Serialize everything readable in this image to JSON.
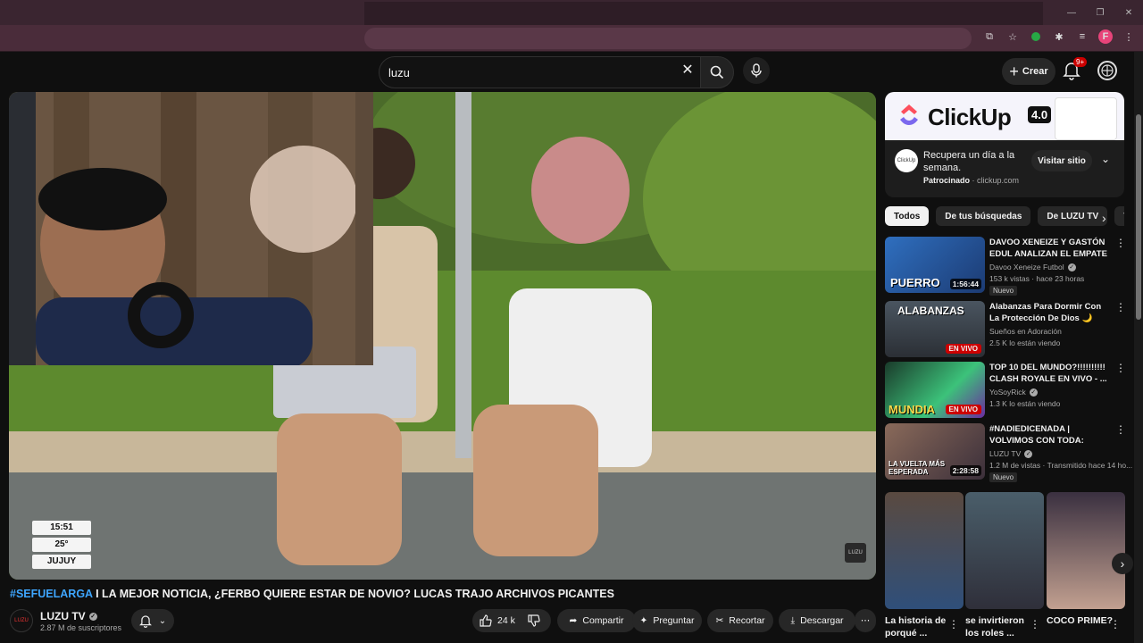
{
  "browser": {
    "window_controls": [
      "—",
      "❐",
      "✕"
    ],
    "profile_initial": "F"
  },
  "topbar": {
    "search_value": "luzu",
    "create_label": "Crear",
    "notifications_badge": "9+"
  },
  "player": {
    "overlay_time": "15:51",
    "overlay_temp": "25°",
    "overlay_city": "JUJUY",
    "watermark": "LUZU"
  },
  "video": {
    "title_tag": "#SEFUELARGA",
    "title_rest": " I LA MEJOR NOTICIA, ¿FERBO QUIERE ESTAR DE NOVIO? LUCAS TRAJO ARCHIVOS PICANTES",
    "channel_name": "LUZU TV",
    "channel_avatar_text": "LUZU",
    "subscribers": "2.87 M de suscriptores",
    "likes": "24 k",
    "share_label": "Compartir",
    "ask_label": "Preguntar",
    "clip_label": "Recortar",
    "download_label": "Descargar"
  },
  "ad": {
    "brand": "ClickUp",
    "version": "4.0",
    "icon_text": "ClickUp",
    "headline": "Recupera un día a la semana.",
    "sponsored": "Patrocinado",
    "domain": "clickup.com",
    "visit_label": "Visitar sitio"
  },
  "chips": [
    "Todos",
    "De tus búsquedas",
    "De LUZU TV",
    "Vi"
  ],
  "recommendations": [
    {
      "title": "DAVOO XENEIZE Y GASTÓN EDUL ANALIZAN EL EMPATE ...",
      "channel": "Davoo Xeneize Futbol",
      "stats": "153 k vistas · hace 23 horas",
      "badge": "Nuevo",
      "duration": "1:56:44",
      "thumb_text": "PUERRO"
    },
    {
      "title": "Alabanzas Para Dormir Con La Protección De Dios 🌙Música ...",
      "channel": "Sueños en Adoración",
      "stats": "2.5 K lo están viendo",
      "live": "EN VIVO",
      "thumb_text": "ALABANZAS"
    },
    {
      "title": "TOP 10 DEL MUNDO?!!!!!!!!!! CLASH ROYALE EN VIVO - ...",
      "channel": "YoSoyRick",
      "stats": "1.3 K lo están viendo",
      "live": "EN VIVO",
      "thumb_text": "MUNDIA"
    },
    {
      "title": "#NADIEDICENADA | VOLVIMOS CON TODA: NUESTRO ...",
      "channel": "LUZU TV",
      "stats": "1.2 M de vistas · Transmitido hace 14 ho...",
      "badge": "Nuevo",
      "duration": "2:28:58",
      "thumb_text": "LA VUELTA MÁS ESPERADA"
    }
  ],
  "shorts": [
    {
      "title": "La historia de porqué ..."
    },
    {
      "title": "se invirtieron los roles ..."
    },
    {
      "title": "COCO PRIME?"
    }
  ],
  "colors": {
    "background": "#0f0f0f",
    "accent_link": "#3ea6ff",
    "live_red": "#cc0000",
    "browser_frame": "#3a2530"
  }
}
